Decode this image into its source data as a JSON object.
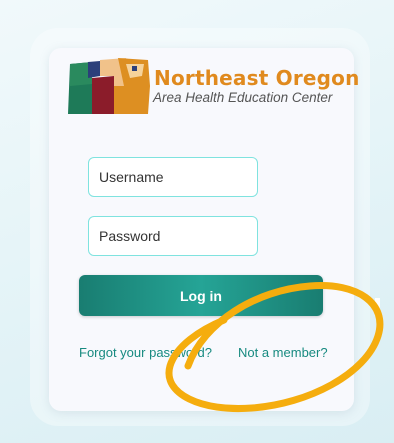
{
  "brand": {
    "title": "Northeast Oregon",
    "subtitle": "Area Health Education Center"
  },
  "form": {
    "username_placeholder": "Username",
    "password_placeholder": "Password",
    "login_label": "Log in"
  },
  "links": {
    "forgot": "Forgot your password?",
    "member": "Not a member?"
  },
  "colors": {
    "accent_orange": "#e08a1e",
    "button_teal": "#1f8f82",
    "link_teal": "#178a80",
    "field_border": "#7fe3df",
    "annotation_yellow": "#f5ad0e"
  }
}
